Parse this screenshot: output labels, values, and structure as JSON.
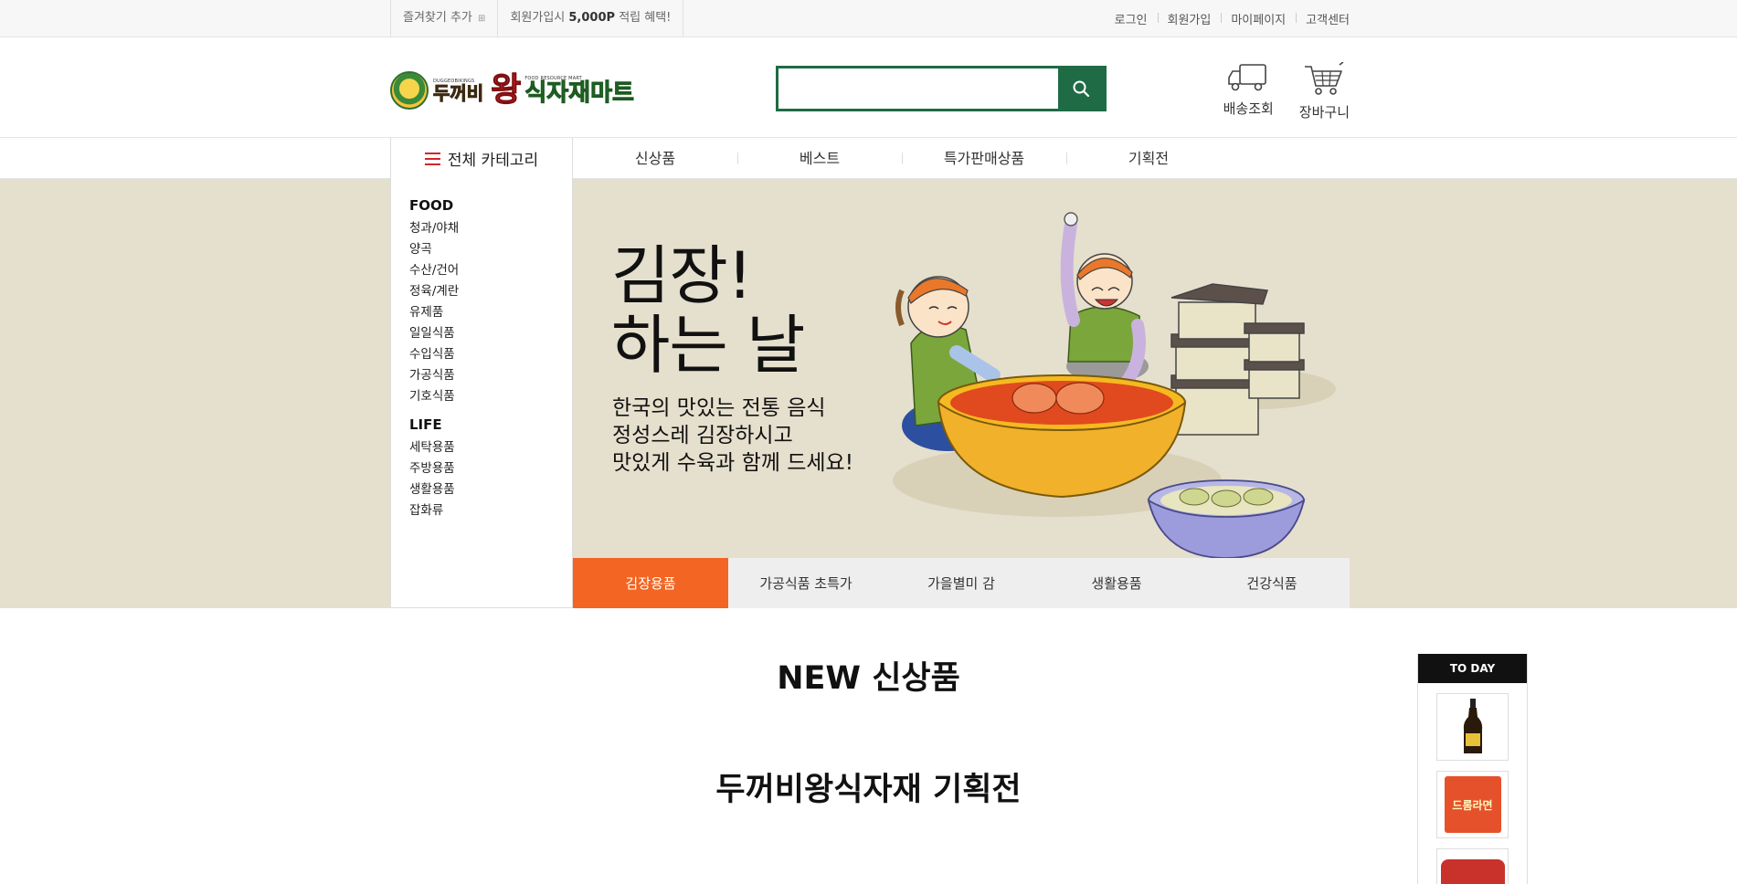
{
  "topbar": {
    "bookmark": "즐겨찾기 추가",
    "bookmark_icon": "plus-box-icon",
    "signup_promo_prefix": "회원가입시",
    "signup_promo_bold": "5,000P",
    "signup_promo_suffix": "적립 혜택!",
    "links": [
      "로그인",
      "회원가입",
      "마이페이지",
      "고객센터"
    ]
  },
  "header": {
    "logo": {
      "brand1_sub": "DUGGEOBIKINGS",
      "brand1_main": "두꺼비",
      "wang": "왕",
      "brand2_sub": "FOOD RESOURCE MART",
      "brand2_main": "식자재마트"
    },
    "search": {
      "placeholder": "",
      "value": ""
    },
    "delivery_label": "배송조회",
    "cart_label": "장바구니"
  },
  "nav": {
    "all_categories": "전체 카테고리",
    "links": [
      "신상품",
      "베스트",
      "특가판매상품",
      "기획전"
    ]
  },
  "sidebar": {
    "groups": [
      {
        "title": "FOOD",
        "items": [
          "청과/야채",
          "양곡",
          "수산/건어",
          "정육/계란",
          "유제품",
          "일일식품",
          "수입식품",
          "가공식품",
          "기호식품"
        ]
      },
      {
        "title": "LIFE",
        "items": [
          "세탁용품",
          "주방용품",
          "생활용품",
          "잡화류"
        ]
      }
    ]
  },
  "banner": {
    "title_line1": "김장!",
    "title_line2": "하는 날",
    "desc_lines": [
      "한국의 맛있는 전통 음식",
      "정성스레 김장하시고",
      "맛있게 수육과 함께 드세요!"
    ],
    "tabs": [
      "김장용품",
      "가공식품 초특가",
      "가을별미 감",
      "생활용품",
      "건강식품"
    ],
    "active_tab": 0
  },
  "sections": {
    "new_title": "NEW 신상품",
    "plan_title": "두꺼비왕식자재 기획전"
  },
  "today": {
    "label": "TO DAY",
    "thumb2_text": "드롬라면"
  },
  "colors": {
    "accent_green": "#1f6b45",
    "tab_active": "#f26522",
    "hero_bg": "#e5dfcd"
  }
}
